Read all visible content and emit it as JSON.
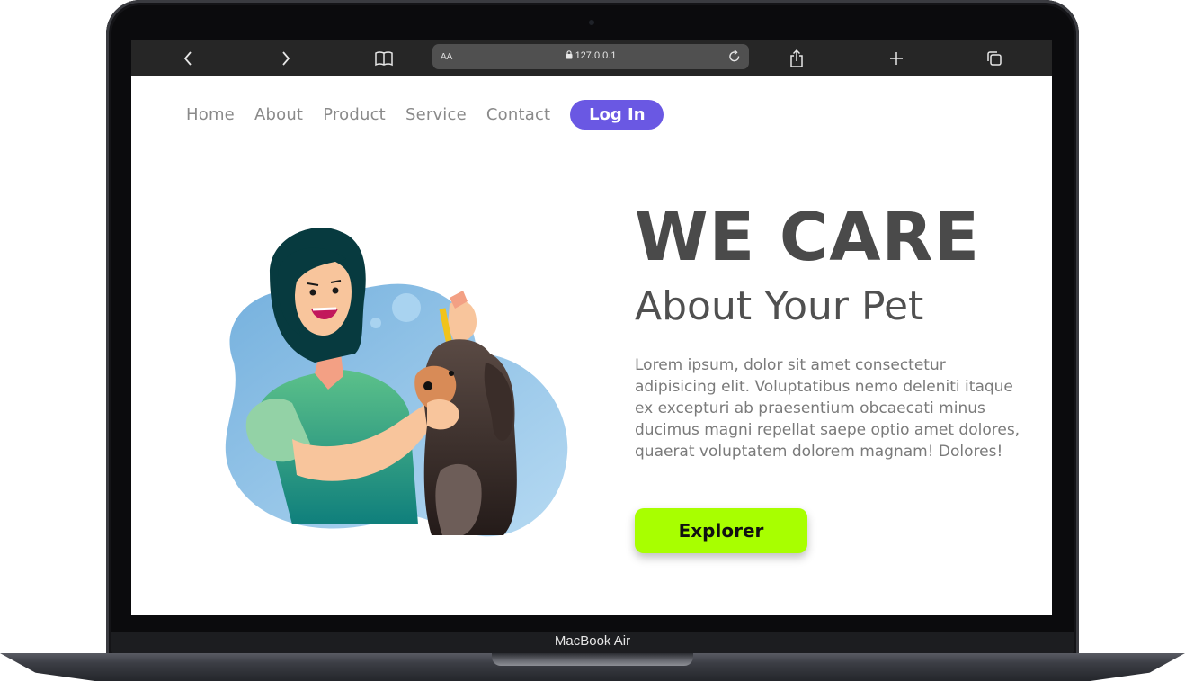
{
  "browser": {
    "url": "127.0.0.1",
    "text_size_label": "AA"
  },
  "nav": {
    "items": [
      "Home",
      "About",
      "Product",
      "Service",
      "Contact"
    ],
    "login_label": "Log In"
  },
  "hero": {
    "title": "WE CARE",
    "subtitle": "About Your Pet",
    "body": "Lorem ipsum, dolor sit amet consectetur adipisicing elit. Voluptatibus nemo deleniti itaque ex excepturi ab praesentium obcaecati minus ducimus magni repellat saepe optio amet dolores, quaerat voluptatem dolorem magnam! Dolores!",
    "cta_label": "Explorer"
  },
  "device": {
    "model_label": "MacBook Air"
  },
  "colors": {
    "login_button": "#6a58e3",
    "cta_button": "#a8ff00",
    "title_text": "#4a4a4a",
    "nav_text": "#8a8a8a",
    "browser_bar": "#262626"
  },
  "icons": {
    "browser_toolbar": [
      "chevron-left-icon",
      "chevron-right-icon",
      "book-icon",
      "lock-icon",
      "reload-icon",
      "share-icon",
      "plus-icon",
      "tabs-icon"
    ],
    "illustration": "woman-with-dog-illustration"
  }
}
